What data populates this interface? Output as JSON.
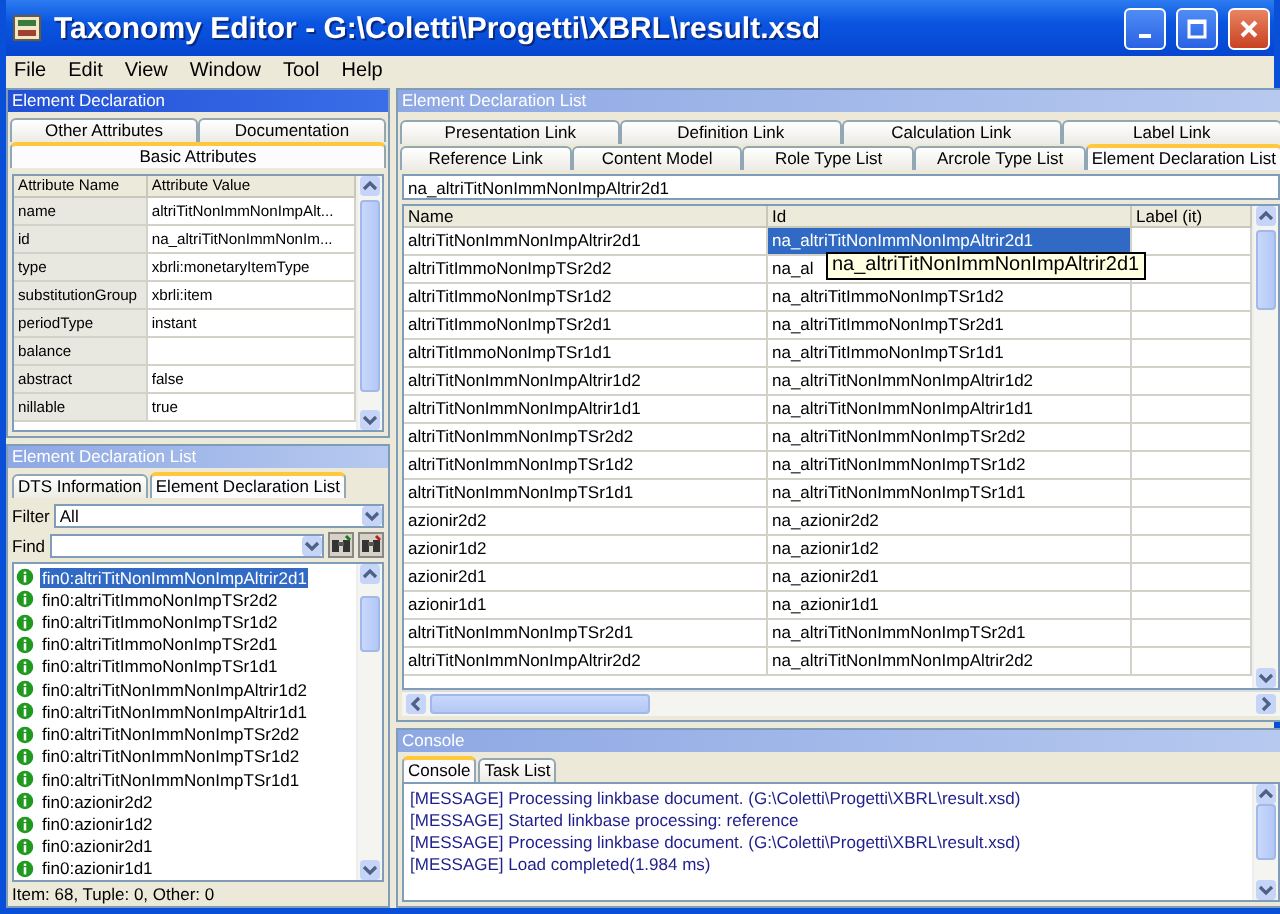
{
  "window": {
    "title": "Taxonomy Editor - G:\\Coletti\\Progetti\\XBRL\\result.xsd"
  },
  "menu": [
    "File",
    "Edit",
    "View",
    "Window",
    "Tool",
    "Help"
  ],
  "element_declaration": {
    "title": "Element Declaration",
    "active": true,
    "tab_rows": [
      [
        {
          "label": "Other Attributes",
          "selected": false
        },
        {
          "label": "Documentation",
          "selected": false
        }
      ],
      [
        {
          "label": "Basic Attributes",
          "selected": true
        }
      ]
    ],
    "columns": [
      "Attribute Name",
      "Attribute Value"
    ],
    "rows": [
      {
        "name": "name",
        "value": "altriTitNonImmNonImpAlt..."
      },
      {
        "name": "id",
        "value": "na_altriTitNonImmNonIm..."
      },
      {
        "name": "type",
        "value": "xbrli:monetaryItemType"
      },
      {
        "name": "substitutionGroup",
        "value": "xbrli:item"
      },
      {
        "name": "periodType",
        "value": "instant"
      },
      {
        "name": "balance"
      },
      {
        "name": "abstract",
        "value": "false"
      },
      {
        "name": "nillable",
        "value": "true"
      }
    ]
  },
  "element_list": {
    "title": "Element Declaration List",
    "active": false,
    "tabs": [
      {
        "label": "DTS Information",
        "selected": false
      },
      {
        "label": "Element Declaration List",
        "selected": true
      }
    ],
    "filter": {
      "label": "Filter",
      "value": "All"
    },
    "find": {
      "label": "Find"
    },
    "items": [
      {
        "label": "fin0:altriTitNonImmNonImpAltrir2d1",
        "selected": true
      },
      {
        "label": "fin0:altriTitImmoNonImpTSr2d2",
        "selected": false
      },
      {
        "label": "fin0:altriTitImmoNonImpTSr1d2",
        "selected": false
      },
      {
        "label": "fin0:altriTitImmoNonImpTSr2d1",
        "selected": false
      },
      {
        "label": "fin0:altriTitImmoNonImpTSr1d1",
        "selected": false
      },
      {
        "label": "fin0:altriTitNonImmNonImpAltrir1d2",
        "selected": false
      },
      {
        "label": "fin0:altriTitNonImmNonImpAltrir1d1",
        "selected": false
      },
      {
        "label": "fin0:altriTitNonImmNonImpTSr2d2",
        "selected": false
      },
      {
        "label": "fin0:altriTitNonImmNonImpTSr1d2",
        "selected": false
      },
      {
        "label": "fin0:altriTitNonImmNonImpTSr1d1",
        "selected": false
      },
      {
        "label": "fin0:azionir2d2",
        "selected": false
      },
      {
        "label": "fin0:azionir1d2",
        "selected": false
      },
      {
        "label": "fin0:azionir2d1",
        "selected": false
      },
      {
        "label": "fin0:azionir1d1",
        "selected": false
      }
    ],
    "status": "Item: 68, Tuple: 0, Other: 0"
  },
  "declaration_table": {
    "title": "Element Declaration List",
    "active": false,
    "tab_rows": [
      [
        {
          "label": "Presentation Link",
          "selected": false
        },
        {
          "label": "Definition Link",
          "selected": false
        },
        {
          "label": "Calculation Link",
          "selected": false
        },
        {
          "label": "Label Link",
          "selected": false
        }
      ],
      [
        {
          "label": "Reference Link",
          "selected": false
        },
        {
          "label": "Content Model",
          "selected": false
        },
        {
          "label": "Role Type List",
          "selected": false
        },
        {
          "label": "Arcrole Type List",
          "selected": false
        },
        {
          "label": "Element Declaration List",
          "selected": true
        }
      ]
    ],
    "field": {
      "value": "na_altriTitNonImmNonImpAltrir2d1"
    },
    "columns": [
      "Name",
      "Id",
      "Label (it)"
    ],
    "rows": [
      {
        "name": "altriTitNonImmNonImpAltrir2d1",
        "id": "na_altriTitNonImmNonImpAltrir2d1",
        "selected": true
      },
      {
        "name": "altriTitImmoNonImpTSr2d2",
        "id": "na_al",
        "selected": false
      },
      {
        "name": "altriTitImmoNonImpTSr1d2",
        "id": "na_altriTitImmoNonImpTSr1d2",
        "selected": false
      },
      {
        "name": "altriTitImmoNonImpTSr2d1",
        "id": "na_altriTitImmoNonImpTSr2d1",
        "selected": false
      },
      {
        "name": "altriTitImmoNonImpTSr1d1",
        "id": "na_altriTitImmoNonImpTSr1d1",
        "selected": false
      },
      {
        "name": "altriTitNonImmNonImpAltrir1d2",
        "id": "na_altriTitNonImmNonImpAltrir1d2",
        "selected": false
      },
      {
        "name": "altriTitNonImmNonImpAltrir1d1",
        "id": "na_altriTitNonImmNonImpAltrir1d1",
        "selected": false
      },
      {
        "name": "altriTitNonImmNonImpTSr2d2",
        "id": "na_altriTitNonImmNonImpTSr2d2",
        "selected": false
      },
      {
        "name": "altriTitNonImmNonImpTSr1d2",
        "id": "na_altriTitNonImmNonImpTSr1d2",
        "selected": false
      },
      {
        "name": "altriTitNonImmNonImpTSr1d1",
        "id": "na_altriTitNonImmNonImpTSr1d1",
        "selected": false
      },
      {
        "name": "azionir2d2",
        "id": "na_azionir2d2",
        "selected": false
      },
      {
        "name": "azionir1d2",
        "id": "na_azionir1d2",
        "selected": false
      },
      {
        "name": "azionir2d1",
        "id": "na_azionir2d1",
        "selected": false
      },
      {
        "name": "azionir1d1",
        "id": "na_azionir1d1",
        "selected": false
      },
      {
        "name": "altriTitNonImmNonImpTSr2d1",
        "id": "na_altriTitNonImmNonImpTSr2d1",
        "selected": false
      },
      {
        "name": "altriTitNonImmNonImpAltrir2d2",
        "id": "na_altriTitNonImmNonImpAltrir2d2",
        "selected": false
      }
    ],
    "tooltip": "na_altriTitNonImmNonImpAltrir2d1"
  },
  "console": {
    "title": "Console",
    "active": false,
    "tabs": [
      {
        "label": "Console",
        "selected": true
      },
      {
        "label": "Task List",
        "selected": false
      }
    ],
    "messages": [
      "[MESSAGE] Processing linkbase document. (G:\\Coletti\\Progetti\\XBRL\\result.xsd)",
      "[MESSAGE] Started linkbase processing: reference",
      "[MESSAGE] Processing linkbase document. (G:\\Coletti\\Progetti\\XBRL\\result.xsd)",
      "[MESSAGE] Load completed(1.984 ms)"
    ]
  }
}
